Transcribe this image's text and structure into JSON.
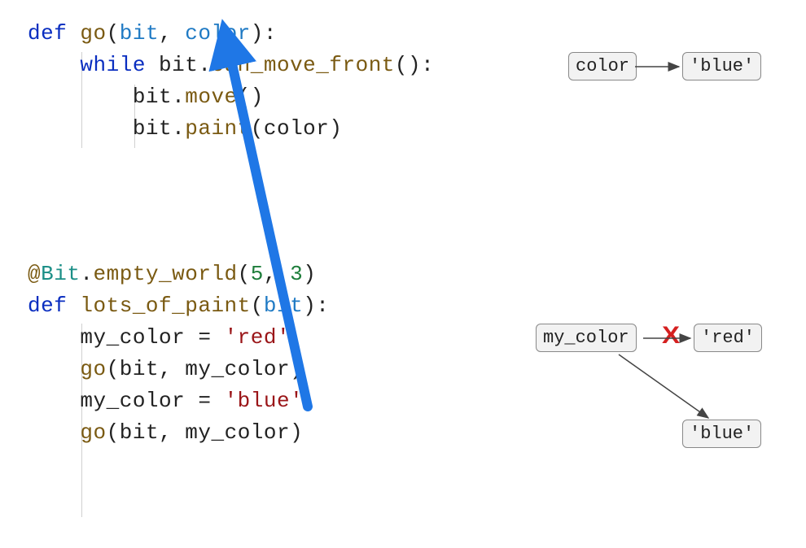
{
  "code_block_1": {
    "l1": {
      "kw": "def",
      "fn": "go",
      "p1": "bit",
      "p2": "color",
      "tail": ":"
    },
    "l2": {
      "indent": "    ",
      "kw": "while",
      "obj": "bit",
      "dot": ".",
      "fn": "can_move_front",
      "parens": "()",
      "tail": ":"
    },
    "l3": {
      "indent": "        ",
      "obj": "bit",
      "dot": ".",
      "fn": "move",
      "parens": "()"
    },
    "l4": {
      "indent": "        ",
      "obj": "bit",
      "dot": ".",
      "fn": "paint",
      "open": "(",
      "arg": "color",
      "close": ")"
    }
  },
  "code_block_2": {
    "l0": {
      "at": "@",
      "cls": "Bit",
      "dot": ".",
      "fn": "empty_world",
      "open": "(",
      "n1": "5",
      "comma": ", ",
      "n2": "3",
      "close": ")"
    },
    "l1": {
      "kw": "def",
      "fn": "lots_of_paint",
      "open": "(",
      "p1": "bit",
      "close": ")",
      "tail": ":"
    },
    "l2": {
      "indent": "    ",
      "var": "my_color",
      "eq": " = ",
      "str": "'red'"
    },
    "l3": {
      "indent": "    ",
      "fn": "go",
      "open": "(",
      "a1": "bit",
      "comma": ", ",
      "a2": "my_color",
      "close": ")"
    },
    "l4": {
      "indent": "    ",
      "var": "my_color",
      "eq": " = ",
      "str": "'blue'"
    },
    "l5": {
      "indent": "    ",
      "fn": "go",
      "open": "(",
      "a1": "bit",
      "comma": ", ",
      "a2": "my_color",
      "close": ")"
    }
  },
  "diagram_top": {
    "box1": "color",
    "box2": "'blue'"
  },
  "diagram_bottom": {
    "box1": "my_color",
    "box2": "'red'",
    "box3": "'blue'",
    "x_mark": "X"
  },
  "colors": {
    "arrow_blue": "#1f77e6",
    "box_border": "#888888",
    "red_x": "#d52020"
  }
}
